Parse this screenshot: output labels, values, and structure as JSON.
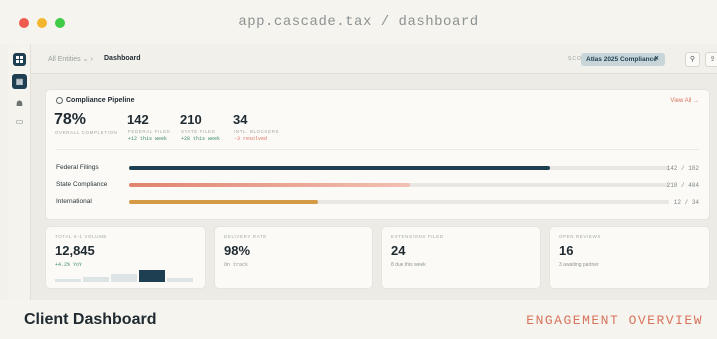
{
  "window": {
    "url": "app.cascade.tax / dashboard"
  },
  "topbar": {
    "breadcrumb_root": "All Entities",
    "breadcrumb_current": "Dashboard",
    "scope_label": "SCOPE",
    "scope_value": "Atlas 2025 Compliance"
  },
  "pipeline": {
    "title": "Compliance Pipeline",
    "view_all": "View All",
    "stats": [
      {
        "value": "78%",
        "label": "OVERALL COMPLETION",
        "delta": ""
      },
      {
        "value": "142",
        "label": "FEDERAL FILED",
        "delta": "+12 this week"
      },
      {
        "value": "210",
        "label": "STATE FILED",
        "delta": "+28 this week"
      },
      {
        "value": "34",
        "label": "INTL. BLOCKERS",
        "delta": "-3 resolved"
      }
    ],
    "rows": [
      {
        "label": "Federal Filings",
        "value": "142 / 182",
        "progress": 0.78,
        "color": "#1e3f52"
      },
      {
        "label": "State Compliance",
        "value": "210 / 404",
        "progress": 0.52,
        "color": "#e0836e"
      },
      {
        "label": "International",
        "value": "12 / 34",
        "progress": 0.35,
        "color": "#d49a45"
      }
    ]
  },
  "metrics": [
    {
      "label": "TOTAL K-1 VOLUME",
      "value": "12,845",
      "sub": "+4.2% YoY"
    },
    {
      "label": "DELIVERY RATE",
      "value": "98%",
      "sub": "On track"
    },
    {
      "label": "EXTENSIONS FILED",
      "value": "24",
      "sub": "8 due this week"
    },
    {
      "label": "OPEN REVIEWS",
      "value": "16",
      "sub": "3 awaiting partner"
    }
  ],
  "footer": {
    "title": "Client Dashboard",
    "tag": "ENGAGEMENT OVERVIEW"
  },
  "colors": {
    "accent": "#1e3f52",
    "coral": "#e0836e",
    "amber": "#d49a45",
    "tag": "#d8735d"
  }
}
